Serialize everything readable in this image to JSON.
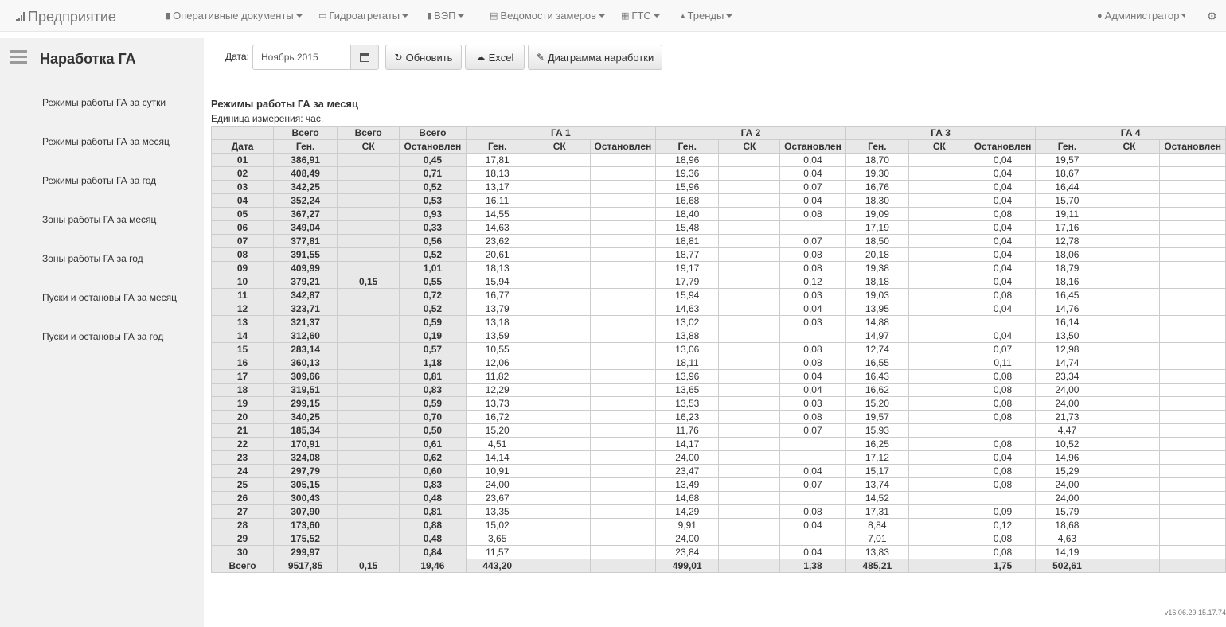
{
  "nav": {
    "brand": "Предприятие",
    "items": [
      {
        "label": "Оперативные документы",
        "icon": "document-icon"
      },
      {
        "label": "Гидроагрегаты",
        "icon": "monitor-icon"
      },
      {
        "label": "ВЭП",
        "icon": "tag-icon"
      },
      {
        "label": "Ведомости замеров",
        "icon": "list-icon"
      },
      {
        "label": "ГТС",
        "icon": "table-icon"
      },
      {
        "label": "Тренды",
        "icon": "chart-icon"
      }
    ],
    "user": "Администратор"
  },
  "sidebar": {
    "title": "Наработка ГА",
    "links": [
      "Режимы работы ГА за сутки",
      "Режимы работы ГА за месяц",
      "Режимы работы ГА за год",
      "Зоны работы ГА за месяц",
      "Зоны работы ГА за год",
      "Пуски и остановы ГА за месяц",
      "Пуски и остановы ГА за год"
    ]
  },
  "toolbar": {
    "date_label": "Дата:",
    "date_value": "Ноябрь 2015",
    "refresh_label": "Обновить",
    "excel_label": "Excel",
    "diagram_label": "Диаграмма наработки"
  },
  "table": {
    "title": "Режимы работы ГА за месяц",
    "unit": "Единица измерения: час.",
    "header_top": {
      "total": "Всего",
      "ga": [
        "ГА 1",
        "ГА 2",
        "ГА 3",
        "ГА 4"
      ]
    },
    "header_sub": {
      "date": "Дата",
      "gen": "Ген.",
      "sk": "СК",
      "stop": "Остановлен"
    },
    "rows": [
      [
        "01",
        "386,91",
        "",
        "0,45",
        "17,81",
        "",
        "",
        "18,96",
        "",
        "0,04",
        "18,70",
        "",
        "0,04",
        "19,57",
        "",
        ""
      ],
      [
        "02",
        "408,49",
        "",
        "0,71",
        "18,13",
        "",
        "",
        "19,36",
        "",
        "0,04",
        "19,30",
        "",
        "0,04",
        "18,67",
        "",
        ""
      ],
      [
        "03",
        "342,25",
        "",
        "0,52",
        "13,17",
        "",
        "",
        "15,96",
        "",
        "0,07",
        "16,76",
        "",
        "0,04",
        "16,44",
        "",
        ""
      ],
      [
        "04",
        "352,24",
        "",
        "0,53",
        "16,11",
        "",
        "",
        "16,68",
        "",
        "0,04",
        "18,30",
        "",
        "0,04",
        "15,70",
        "",
        ""
      ],
      [
        "05",
        "367,27",
        "",
        "0,93",
        "14,55",
        "",
        "",
        "18,40",
        "",
        "0,08",
        "19,09",
        "",
        "0,08",
        "19,11",
        "",
        ""
      ],
      [
        "06",
        "349,04",
        "",
        "0,33",
        "14,63",
        "",
        "",
        "15,48",
        "",
        "",
        "17,19",
        "",
        "0,04",
        "17,16",
        "",
        ""
      ],
      [
        "07",
        "377,81",
        "",
        "0,56",
        "23,62",
        "",
        "",
        "18,81",
        "",
        "0,07",
        "18,50",
        "",
        "0,04",
        "12,78",
        "",
        ""
      ],
      [
        "08",
        "391,55",
        "",
        "0,52",
        "20,61",
        "",
        "",
        "18,77",
        "",
        "0,08",
        "20,18",
        "",
        "0,04",
        "18,06",
        "",
        ""
      ],
      [
        "09",
        "409,99",
        "",
        "1,01",
        "18,13",
        "",
        "",
        "19,17",
        "",
        "0,08",
        "19,38",
        "",
        "0,04",
        "18,79",
        "",
        ""
      ],
      [
        "10",
        "379,21",
        "0,15",
        "0,55",
        "15,94",
        "",
        "",
        "17,79",
        "",
        "0,12",
        "18,18",
        "",
        "0,04",
        "18,16",
        "",
        ""
      ],
      [
        "11",
        "342,87",
        "",
        "0,72",
        "16,77",
        "",
        "",
        "15,94",
        "",
        "0,03",
        "19,03",
        "",
        "0,08",
        "16,45",
        "",
        ""
      ],
      [
        "12",
        "323,71",
        "",
        "0,52",
        "13,79",
        "",
        "",
        "14,63",
        "",
        "0,04",
        "13,95",
        "",
        "0,04",
        "14,76",
        "",
        ""
      ],
      [
        "13",
        "321,37",
        "",
        "0,59",
        "13,18",
        "",
        "",
        "13,02",
        "",
        "0,03",
        "14,88",
        "",
        "",
        "16,14",
        "",
        ""
      ],
      [
        "14",
        "312,60",
        "",
        "0,19",
        "13,59",
        "",
        "",
        "13,88",
        "",
        "",
        "14,97",
        "",
        "0,04",
        "13,50",
        "",
        ""
      ],
      [
        "15",
        "283,14",
        "",
        "0,57",
        "10,55",
        "",
        "",
        "13,06",
        "",
        "0,08",
        "12,74",
        "",
        "0,07",
        "12,98",
        "",
        ""
      ],
      [
        "16",
        "360,13",
        "",
        "1,18",
        "12,06",
        "",
        "",
        "18,11",
        "",
        "0,08",
        "16,55",
        "",
        "0,11",
        "14,74",
        "",
        ""
      ],
      [
        "17",
        "309,66",
        "",
        "0,81",
        "11,82",
        "",
        "",
        "13,96",
        "",
        "0,04",
        "16,43",
        "",
        "0,08",
        "23,34",
        "",
        ""
      ],
      [
        "18",
        "319,51",
        "",
        "0,83",
        "12,29",
        "",
        "",
        "13,65",
        "",
        "0,04",
        "16,62",
        "",
        "0,08",
        "24,00",
        "",
        ""
      ],
      [
        "19",
        "299,15",
        "",
        "0,59",
        "13,73",
        "",
        "",
        "13,53",
        "",
        "0,03",
        "15,20",
        "",
        "0,08",
        "24,00",
        "",
        ""
      ],
      [
        "20",
        "340,25",
        "",
        "0,70",
        "16,72",
        "",
        "",
        "16,23",
        "",
        "0,08",
        "19,57",
        "",
        "0,08",
        "21,73",
        "",
        ""
      ],
      [
        "21",
        "185,34",
        "",
        "0,50",
        "15,20",
        "",
        "",
        "11,76",
        "",
        "0,07",
        "15,93",
        "",
        "",
        "4,47",
        "",
        ""
      ],
      [
        "22",
        "170,91",
        "",
        "0,61",
        "4,51",
        "",
        "",
        "14,17",
        "",
        "",
        "16,25",
        "",
        "0,08",
        "10,52",
        "",
        ""
      ],
      [
        "23",
        "324,08",
        "",
        "0,62",
        "14,14",
        "",
        "",
        "24,00",
        "",
        "",
        "17,12",
        "",
        "0,04",
        "14,96",
        "",
        ""
      ],
      [
        "24",
        "297,79",
        "",
        "0,60",
        "10,91",
        "",
        "",
        "23,47",
        "",
        "0,04",
        "15,17",
        "",
        "0,08",
        "15,29",
        "",
        ""
      ],
      [
        "25",
        "305,15",
        "",
        "0,83",
        "24,00",
        "",
        "",
        "13,49",
        "",
        "0,07",
        "13,74",
        "",
        "0,08",
        "24,00",
        "",
        ""
      ],
      [
        "26",
        "300,43",
        "",
        "0,48",
        "23,67",
        "",
        "",
        "14,68",
        "",
        "",
        "14,52",
        "",
        "",
        "24,00",
        "",
        ""
      ],
      [
        "27",
        "307,90",
        "",
        "0,81",
        "13,35",
        "",
        "",
        "14,29",
        "",
        "0,08",
        "17,31",
        "",
        "0,09",
        "15,79",
        "",
        ""
      ],
      [
        "28",
        "173,60",
        "",
        "0,88",
        "15,02",
        "",
        "",
        "9,91",
        "",
        "0,04",
        "8,84",
        "",
        "0,12",
        "18,68",
        "",
        ""
      ],
      [
        "29",
        "175,52",
        "",
        "0,48",
        "3,65",
        "",
        "",
        "24,00",
        "",
        "",
        "7,01",
        "",
        "0,08",
        "4,63",
        "",
        ""
      ],
      [
        "30",
        "299,97",
        "",
        "0,84",
        "11,57",
        "",
        "",
        "23,84",
        "",
        "0,04",
        "13,83",
        "",
        "0,08",
        "14,19",
        "",
        ""
      ]
    ],
    "totals": [
      "Всего",
      "9517,85",
      "0,15",
      "19,46",
      "443,20",
      "",
      "",
      "499,01",
      "",
      "1,38",
      "485,21",
      "",
      "1,75",
      "502,61",
      "",
      ""
    ]
  },
  "version": "v16.06.29 15.17.74"
}
